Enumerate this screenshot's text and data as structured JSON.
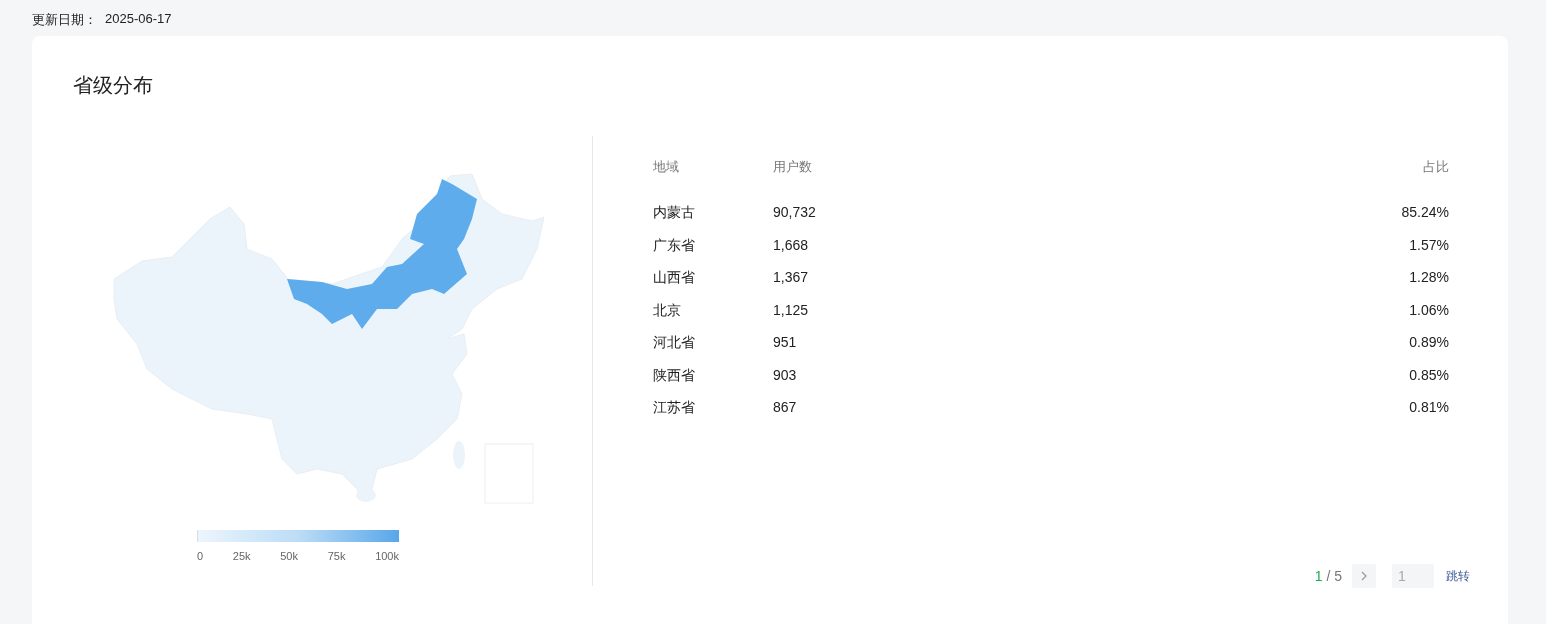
{
  "update": {
    "label": "更新日期：",
    "value": "2025-06-17"
  },
  "card": {
    "title": "省级分布"
  },
  "map": {
    "scale_labels": [
      "0",
      "25k",
      "50k",
      "75k",
      "100k"
    ]
  },
  "table": {
    "columns": [
      "地域",
      "用户数",
      "占比"
    ],
    "rows": [
      {
        "region": "内蒙古",
        "users": "90,732",
        "share": "85.24%"
      },
      {
        "region": "广东省",
        "users": "1,668",
        "share": "1.57%"
      },
      {
        "region": "山西省",
        "users": "1,367",
        "share": "1.28%"
      },
      {
        "region": "北京",
        "users": "1,125",
        "share": "1.06%"
      },
      {
        "region": "河北省",
        "users": "951",
        "share": "0.89%"
      },
      {
        "region": "陕西省",
        "users": "903",
        "share": "0.85%"
      },
      {
        "region": "江苏省",
        "users": "867",
        "share": "0.81%"
      }
    ]
  },
  "pagination": {
    "current": "1",
    "total": "/ 5",
    "jump_value": "1",
    "jump_label": "跳转"
  }
}
